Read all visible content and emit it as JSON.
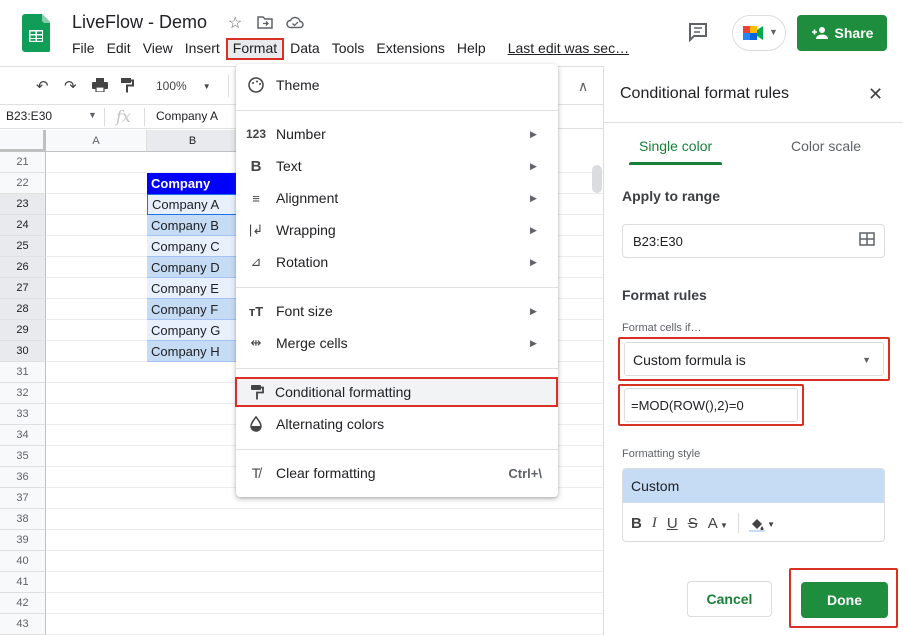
{
  "header": {
    "doc_title": "LiveFlow - Demo",
    "menus": [
      "File",
      "Edit",
      "View",
      "Insert",
      "Format",
      "Data",
      "Tools",
      "Extensions",
      "Help"
    ],
    "last_edit": "Last edit was sec…",
    "share_label": "Share",
    "colors": {
      "share": "#1e8e3e",
      "highlight": "#d93025"
    }
  },
  "toolbar": {
    "zoom": "100%"
  },
  "formula_bar": {
    "name_box": "B23:E30",
    "fx": "fx",
    "value": "Company A"
  },
  "grid": {
    "columns": [
      "A",
      "B"
    ],
    "rows": [
      "21",
      "22",
      "23",
      "24",
      "25",
      "26",
      "27",
      "28",
      "29",
      "30",
      "31",
      "32",
      "33",
      "34",
      "35",
      "36",
      "37",
      "38",
      "39",
      "40",
      "41",
      "42",
      "43"
    ],
    "cells": [
      "Company",
      "Company A",
      "Company B",
      "Company C",
      "Company D",
      "Company E",
      "Company F",
      "Company G",
      "Company H"
    ]
  },
  "format_menu": {
    "items": [
      {
        "icon": "palette-icon",
        "label": "Theme"
      },
      {
        "icon": "number-icon",
        "label": "Number"
      },
      {
        "icon": "bold-text-icon",
        "label": "Text"
      },
      {
        "icon": "alignment-icon",
        "label": "Alignment"
      },
      {
        "icon": "wrapping-icon",
        "label": "Wrapping"
      },
      {
        "icon": "rotation-icon",
        "label": "Rotation"
      },
      {
        "icon": "font-size-icon",
        "label": "Font size"
      },
      {
        "icon": "merge-cells-icon",
        "label": "Merge cells"
      },
      {
        "icon": "paint-roller-icon",
        "label": "Conditional formatting"
      },
      {
        "icon": "drop-icon",
        "label": "Alternating colors"
      },
      {
        "icon": "clear-format-icon",
        "label": "Clear formatting",
        "shortcut": "Ctrl+\\"
      }
    ]
  },
  "panel": {
    "title": "Conditional format rules",
    "tabs": [
      "Single color",
      "Color scale"
    ],
    "apply_to_range_label": "Apply to range",
    "range_value": "B23:E30",
    "format_rules_label": "Format rules",
    "format_cells_if_label": "Format cells if…",
    "condition_value": "Custom formula is",
    "formula_value": "=MOD(ROW(),2)=0",
    "formatting_style_label": "Formatting style",
    "style_preview": "Custom",
    "style_tools": [
      "B",
      "I",
      "U",
      "S",
      "A"
    ],
    "cancel_label": "Cancel",
    "done_label": "Done",
    "colors": {
      "accent": "#188038",
      "preview_fill": "#c6dcf5"
    }
  }
}
